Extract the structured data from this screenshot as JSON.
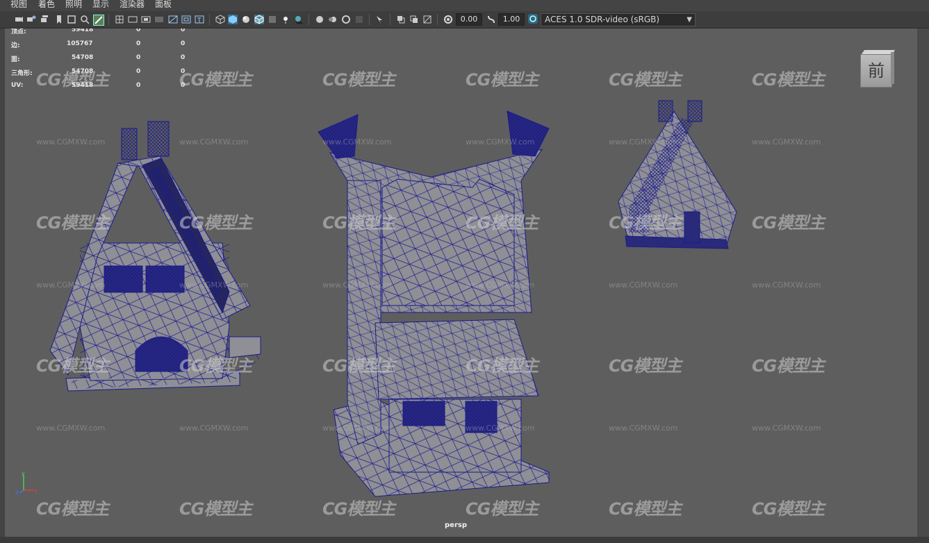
{
  "menu": [
    "视图",
    "着色",
    "照明",
    "显示",
    "渲染器",
    "面板"
  ],
  "toolbar": {
    "exposure": "0.00",
    "gamma": "1.00",
    "color_space": "ACES 1.0 SDR-video (sRGB)"
  },
  "hud": {
    "rows": [
      {
        "label": "顶点:",
        "value": "59418",
        "v2": "0",
        "v3": "0"
      },
      {
        "label": "边:",
        "value": "105767",
        "v2": "0",
        "v3": "0"
      },
      {
        "label": "面:",
        "value": "54708",
        "v2": "0",
        "v3": "0"
      },
      {
        "label": "三角形:",
        "value": "54708",
        "v2": "0",
        "v3": "0"
      },
      {
        "label": "UV:",
        "value": "59418",
        "v2": "0",
        "v3": "0"
      }
    ]
  },
  "viewcube": {
    "face_label": "前"
  },
  "camera_label": "persp",
  "axis": {
    "x": "x",
    "y": "y",
    "z": "z"
  },
  "watermark": {
    "logo": "CG模型主",
    "url": "www.CGMXW.com"
  },
  "colors": {
    "wire": "#1a1a8c",
    "mesh": "#8f8f95",
    "viewport_bg": "#5e5e5e"
  }
}
